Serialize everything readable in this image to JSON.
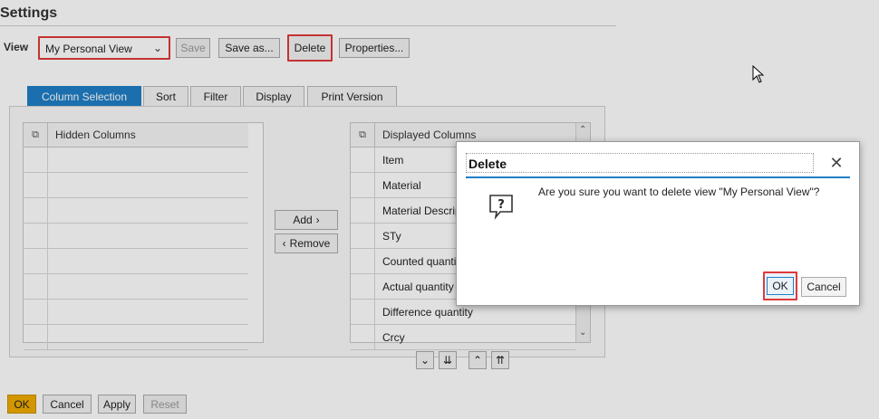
{
  "page": {
    "title": "Settings"
  },
  "view": {
    "label": "View",
    "selected": "My Personal View",
    "buttons": {
      "save": "Save",
      "save_as": "Save as...",
      "delete": "Delete",
      "properties": "Properties..."
    }
  },
  "tabs": [
    "Column Selection",
    "Sort",
    "Filter",
    "Display",
    "Print Version"
  ],
  "hidden_columns": {
    "header": "Hidden Columns",
    "rows": [
      "",
      "",
      "",
      "",
      "",
      "",
      "",
      ""
    ]
  },
  "move_buttons": {
    "add": "Add",
    "remove": "Remove"
  },
  "displayed_columns": {
    "header": "Displayed Columns",
    "rows": [
      "Item",
      "Material",
      "Material Descrip",
      "STy",
      "Counted quantit",
      "Actual quantity",
      "Difference quantity",
      "Crcy"
    ]
  },
  "footer": {
    "ok": "OK",
    "cancel": "Cancel",
    "apply": "Apply",
    "reset": "Reset"
  },
  "dialog": {
    "title": "Delete",
    "message": "Are you sure you want to delete view \"My Personal View\"?",
    "ok": "OK",
    "cancel": "Cancel"
  },
  "colors": {
    "accent": "#1f7fc6",
    "highlight": "#e03a3a",
    "ok_button": "#f0ab00"
  }
}
